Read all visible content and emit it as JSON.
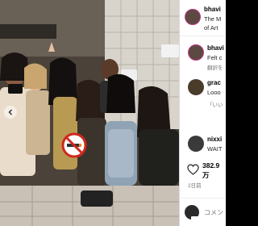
{
  "post": {
    "author_username": "bhavi",
    "caption_lines": [
      "The M",
      "of Art"
    ],
    "icons": {
      "previous": "chevron-left-icon",
      "like": "heart-icon",
      "emoji": "emoji-icon",
      "no_smoking": "no-smoking-sign"
    }
  },
  "comments": [
    {
      "username": "bhavi",
      "text": "Felt c",
      "translate": "翻訳を"
    },
    {
      "username": "grac",
      "text": "Looo",
      "reply_quote": "「いい"
    },
    {
      "username": "nixxi",
      "text": "WAIT"
    }
  ],
  "stats": {
    "likes": "382.9",
    "likes_unit": "万",
    "posted": "2日前"
  },
  "comment_box": {
    "placeholder": "コメン"
  },
  "colors": {
    "story_ring": "#c13584",
    "panel_bg": "#ffffff",
    "border": "#dbdbdb",
    "secondary_text": "#737373"
  }
}
